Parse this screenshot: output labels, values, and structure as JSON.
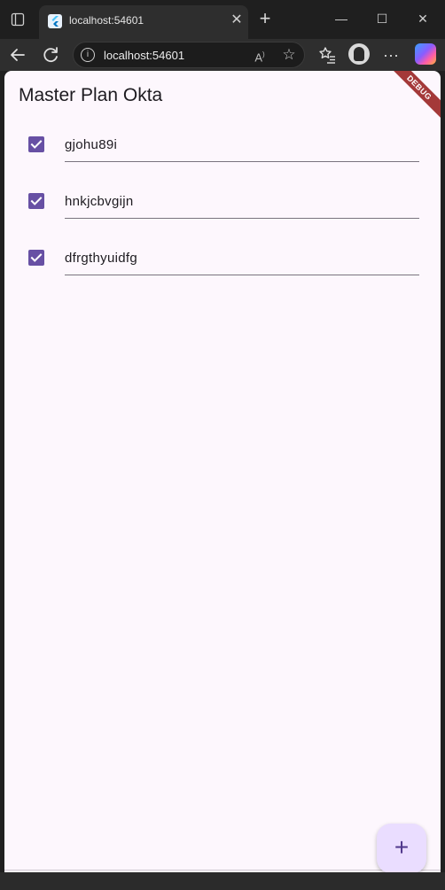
{
  "browser": {
    "tab_title": "localhost:54601",
    "new_tab_glyph": "+",
    "tab_close_glyph": "✕",
    "url": "localhost:54601",
    "window_controls": {
      "minimize": "—",
      "maximize": "☐",
      "close": "✕"
    },
    "icons": {
      "back": "back-arrow-icon",
      "reload": "reload-icon",
      "info": "info-icon",
      "read_aloud": "read-aloud-icon",
      "favorite": "star-icon",
      "favorites_list": "favorites-icon",
      "more": "more-icon",
      "copilot": "copilot-icon"
    }
  },
  "app": {
    "title": "Master Plan Okta",
    "debug_label": "DEBUG",
    "tasks": [
      {
        "text": "gjohu89i",
        "checked": true
      },
      {
        "text": "hnkjcbvgijn",
        "checked": true
      },
      {
        "text": "dfrgthyuidfg",
        "checked": true
      }
    ],
    "fab_glyph": "+"
  },
  "colors": {
    "accent": "#6750a4",
    "fab_bg": "#eaddff",
    "surface": "#fdf7fd",
    "debug_ribbon": "#a43939"
  }
}
